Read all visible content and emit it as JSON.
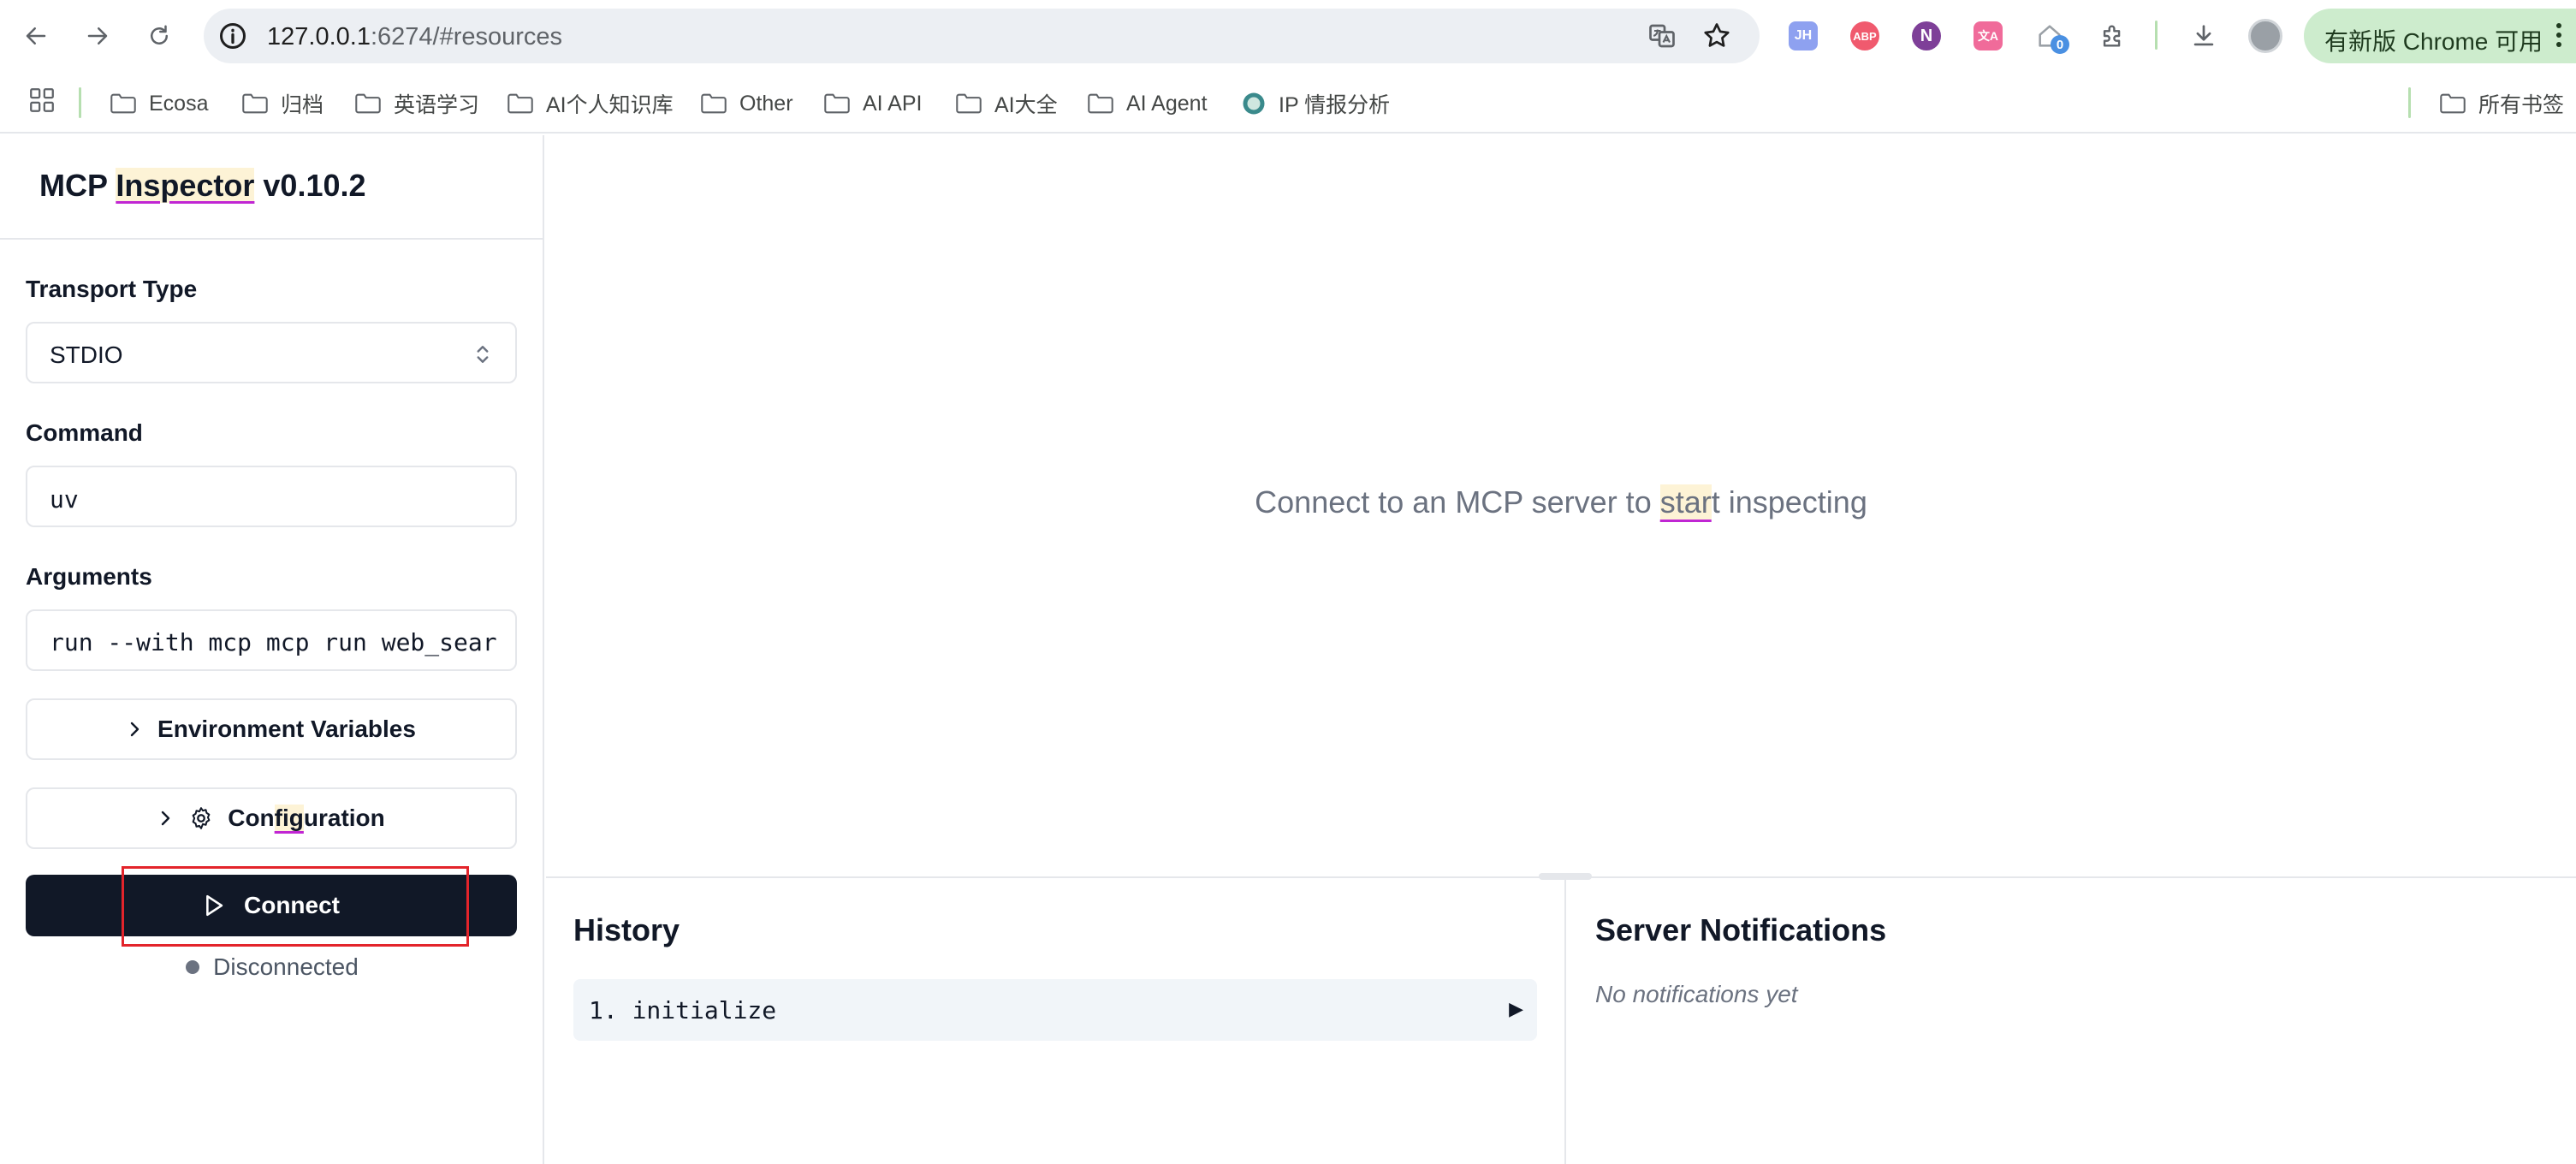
{
  "browser": {
    "url_host": "127.0.0.1",
    "url_rest": ":6274/#resources",
    "update_label": "有新版 Chrome 可用",
    "extensions": [
      {
        "icon": "jh-extension-icon",
        "label": "JH",
        "color": "#8ea1f0"
      },
      {
        "icon": "adblock-extension-icon",
        "label": "ABP",
        "color": "#f05a6e"
      },
      {
        "icon": "n-extension-icon",
        "label": "N",
        "color": "#7e3f98"
      },
      {
        "icon": "translate-extension-icon",
        "label": "文A",
        "color": "#f06b9a"
      }
    ],
    "home_badge": "0",
    "bookmarks": [
      {
        "label": "Ecosa",
        "icon": "folder-icon"
      },
      {
        "label": "归档",
        "icon": "folder-icon"
      },
      {
        "label": "英语学习",
        "icon": "folder-icon"
      },
      {
        "label": "AI个人知识库",
        "icon": "folder-icon"
      },
      {
        "label": "Other",
        "icon": "folder-icon"
      },
      {
        "label": "AI API",
        "icon": "folder-icon"
      },
      {
        "label": "AI大全",
        "icon": "folder-icon"
      },
      {
        "label": "AI Agent",
        "icon": "folder-icon"
      },
      {
        "label": "IP 情报分析",
        "icon": "globe-icon"
      }
    ],
    "all_bookmarks": "所有书签"
  },
  "sidebar": {
    "title_prefix": "MCP ",
    "title_highlight": "Inspector",
    "title_suffix": " v0.10.2",
    "transport_label": "Transport Type",
    "transport_value": "STDIO",
    "command_label": "Command",
    "command_value": "uv",
    "arguments_label": "Arguments",
    "arguments_value": "run --with mcp mcp run web_sear",
    "env_button": "Environment Variables",
    "config_button_pre": "Con",
    "config_button_hl": "fig",
    "config_button_post": "uration",
    "connect_button": "Connect",
    "status": "Disconnected",
    "status_color": "#6b7280"
  },
  "main": {
    "empty_pre": "Connect to an MCP server to ",
    "empty_hl": "star",
    "empty_post": "t inspecting"
  },
  "history": {
    "title": "History",
    "items": [
      {
        "label": "1. initialize",
        "toggle": "▶"
      }
    ]
  },
  "notifications": {
    "title": "Server Notifications",
    "empty": "No notifications yet"
  },
  "colors": {
    "primary_button": "#111827",
    "annotation_box": "#e3242b",
    "highlight_bg": "#fdf3d6",
    "highlight_underline": "#c026d3"
  }
}
